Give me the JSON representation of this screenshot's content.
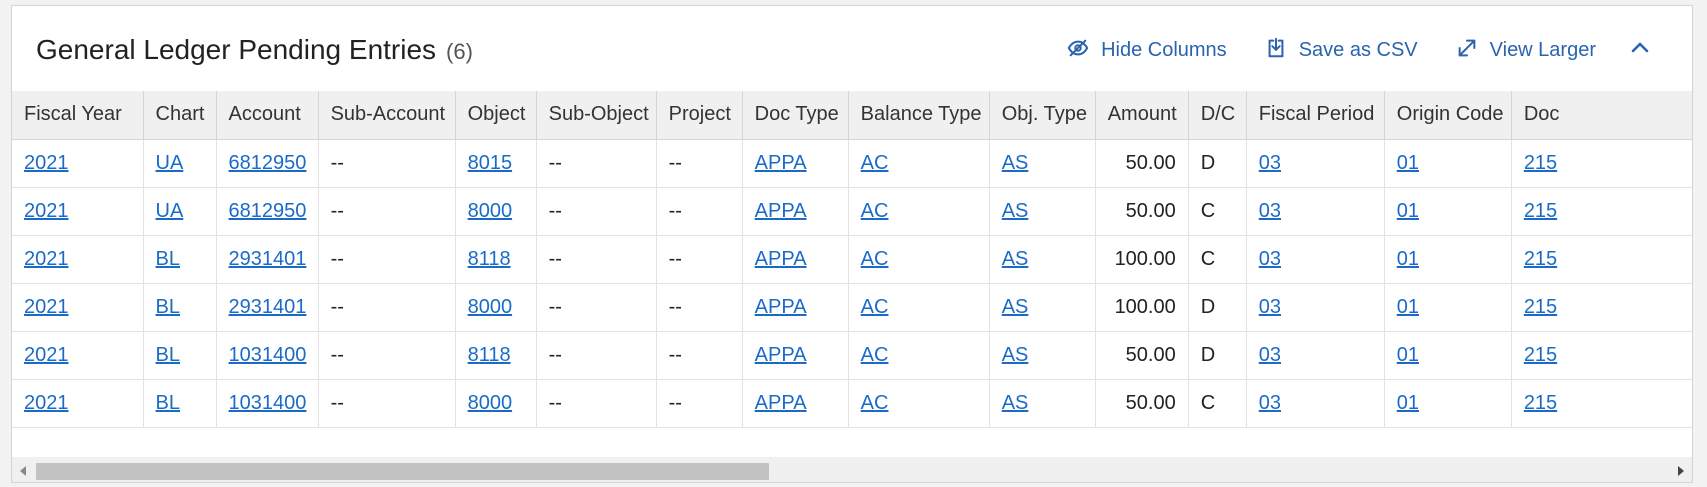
{
  "panel": {
    "title": "General Ledger Pending Entries",
    "count": "(6)",
    "actions": {
      "hide_columns": "Hide Columns",
      "save_csv": "Save as CSV",
      "view_larger": "View Larger"
    }
  },
  "table": {
    "columns": [
      "Fiscal Year",
      "Chart",
      "Account",
      "Sub-Account",
      "Object",
      "Sub-Object",
      "Project",
      "Doc Type",
      "Balance Type",
      "Obj. Type",
      "Amount",
      "D/C",
      "Fiscal Period",
      "Origin Code",
      "Doc"
    ],
    "rows": [
      [
        "2021",
        "UA",
        "6812950",
        "--",
        "8015",
        "--",
        "--",
        "APPA",
        "AC",
        "AS",
        "50.00",
        "D",
        "03",
        "01",
        "215"
      ],
      [
        "2021",
        "UA",
        "6812950",
        "--",
        "8000",
        "--",
        "--",
        "APPA",
        "AC",
        "AS",
        "50.00",
        "C",
        "03",
        "01",
        "215"
      ],
      [
        "2021",
        "BL",
        "2931401",
        "--",
        "8118",
        "--",
        "--",
        "APPA",
        "AC",
        "AS",
        "100.00",
        "C",
        "03",
        "01",
        "215"
      ],
      [
        "2021",
        "BL",
        "2931401",
        "--",
        "8000",
        "--",
        "--",
        "APPA",
        "AC",
        "AS",
        "100.00",
        "D",
        "03",
        "01",
        "215"
      ],
      [
        "2021",
        "BL",
        "1031400",
        "--",
        "8118",
        "--",
        "--",
        "APPA",
        "AC",
        "AS",
        "50.00",
        "D",
        "03",
        "01",
        "215"
      ],
      [
        "2021",
        "BL",
        "1031400",
        "--",
        "8000",
        "--",
        "--",
        "APPA",
        "AC",
        "AS",
        "50.00",
        "C",
        "03",
        "01",
        "215"
      ]
    ]
  },
  "icons": {
    "hide_columns": "eye-slash-icon",
    "save_csv": "download-icon",
    "view_larger": "expand-icon",
    "collapse": "chevron-up-icon"
  },
  "colors": {
    "link": "#1a6bc9",
    "action": "#2a64b0",
    "header_bg": "#f0f0f0"
  }
}
